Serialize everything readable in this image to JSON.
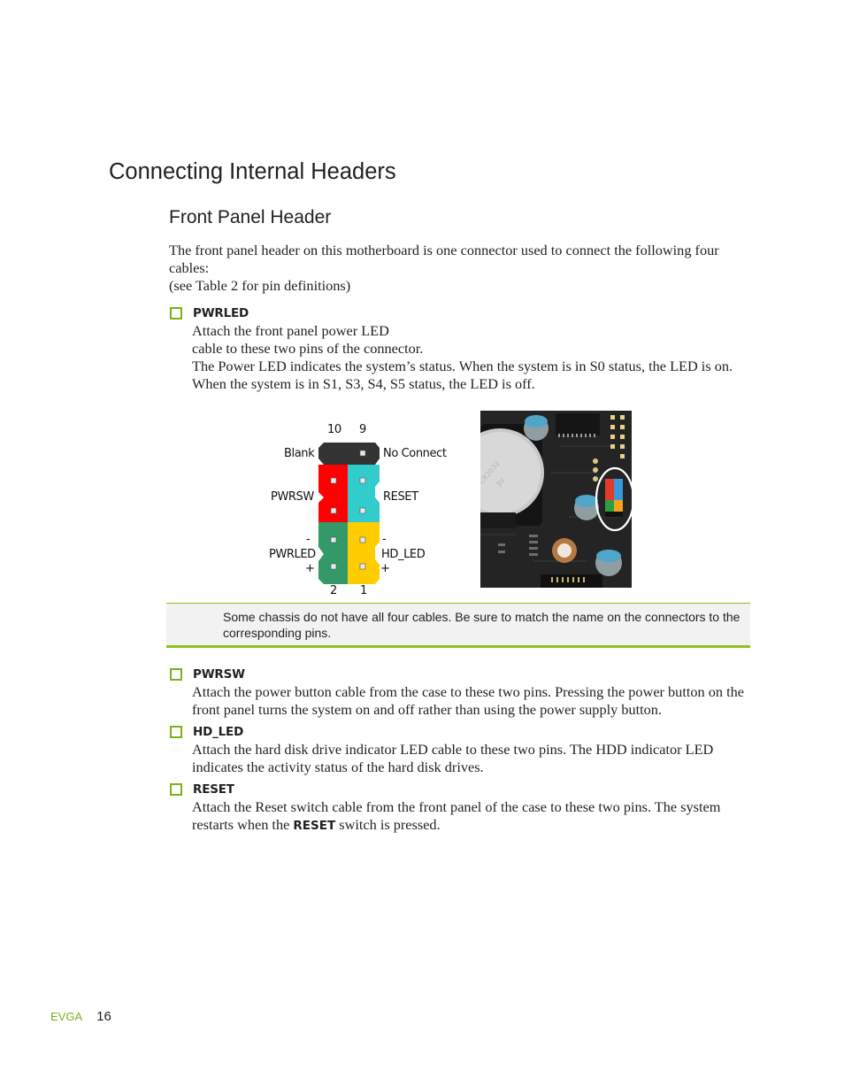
{
  "page": {
    "title": "Connecting Internal Headers",
    "subtitle": "Front Panel Header",
    "intro": {
      "line1": "The front panel header on this motherboard is one connector used to connect the following four cables:",
      "line2": "(see Table 2 for pin definitions)"
    }
  },
  "bullets": [
    {
      "term": "PWRLED",
      "lines": [
        "Attach the front panel power LED",
        "cable to these two pins of the connector.",
        "The Power LED indicates the system’s status. When the system is in S0 status, the LED is on. When the system is in S1, S3, S4, S5 status, the LED is off."
      ]
    },
    {
      "term": "PWRSW",
      "text": "Attach the power button cable from the case to these two pins. Pressing the power button on the front panel turns the system on and off rather than using the power supply button."
    },
    {
      "term": "HD_LED",
      "text": "Attach the hard disk drive indicator LED cable to these two pins. The HDD indicator LED indicates the activity status of the hard disk drives."
    },
    {
      "term": "RESET",
      "text_before": "Attach the Reset switch cable from the front panel of the case to these two pins. The system restarts when the ",
      "bold": "RESET",
      "text_after": " switch is pressed."
    }
  ],
  "diagram": {
    "pin_numbers": {
      "top_left": "10",
      "top_right": "9",
      "bottom_left": "2",
      "bottom_right": "1"
    },
    "labels": {
      "blank": "Blank",
      "no_connect": "No Connect",
      "pwrsw": "PWRSW",
      "reset": "RESET",
      "pwrled": "PWRLED",
      "hd_led": "HD_LED",
      "minus": "-",
      "plus": "+"
    },
    "colors": {
      "blank": "#333333",
      "pwrsw": "#ff0000",
      "reset": "#33cccc",
      "pwrled": "#339966",
      "hd_led": "#ffcc00",
      "pin": "#e4e8f0"
    }
  },
  "note": {
    "text": "Some chassis do not have all four cables. Be sure to match the name on the connectors to the corresponding pins."
  },
  "footer": {
    "brand": "EVGA",
    "page_number": "16"
  },
  "theme": {
    "accent": "#7ab317"
  }
}
